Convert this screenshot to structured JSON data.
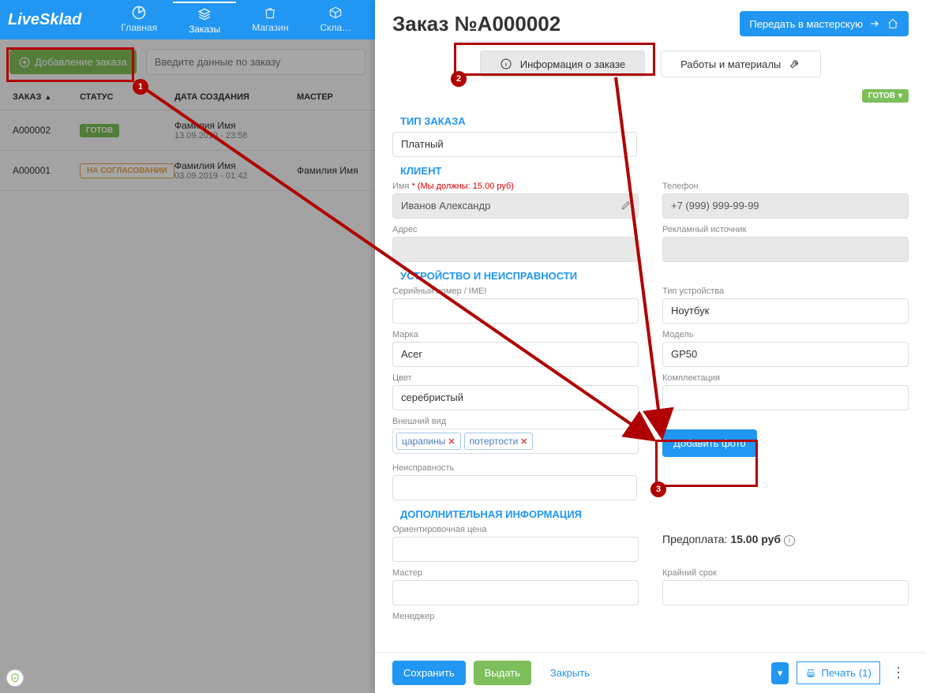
{
  "colors": {
    "primary": "#2196f3",
    "success": "#7dbf5a",
    "danger": "#b00000"
  },
  "nav": {
    "logo": "LiveSklad",
    "items": [
      {
        "label": "Главная",
        "icon": "pie"
      },
      {
        "label": "Заказы",
        "icon": "stack",
        "active": true
      },
      {
        "label": "Магазин",
        "icon": "bag"
      },
      {
        "label": "Скла…",
        "icon": "box"
      }
    ]
  },
  "toolbar": {
    "add_label": "Добавление заказа",
    "search_placeholder": "Введите данные по заказу"
  },
  "table": {
    "headers": {
      "id": "ЗАКАЗ",
      "status": "СТАТУС",
      "created": "ДАТА СОЗДАНИЯ",
      "master": "МАСТЕР"
    },
    "rows": [
      {
        "id": "A000002",
        "status": "ГОТОВ",
        "status_kind": "green",
        "name": "Фамилия Имя",
        "date": "13.09.2019 - 23:58",
        "master": ""
      },
      {
        "id": "A000001",
        "status": "НА СОГЛАСОВАНИИ",
        "status_kind": "orange",
        "name": "Фамилия Имя",
        "date": "03.09.2019 - 01:42",
        "master": "Фамилия Имя"
      }
    ]
  },
  "panel": {
    "title": "Заказ №А000002",
    "transfer_label": "Передать в мастерскую",
    "tabs": {
      "info": "Информация о заказе",
      "work": "Работы и материалы"
    },
    "status_pill": "ГОТОВ",
    "sections": {
      "order_type": {
        "title": "ТИП ЗАКАЗА",
        "value": "Платный"
      },
      "client": {
        "title": "КЛИЕНТ",
        "name_label": "Имя",
        "debt_text": "(Мы должны: 15.00 руб)",
        "name_value": "Иванов Александр",
        "phone_label": "Телефон",
        "phone_value": "+7 (999) 999-99-99",
        "address_label": "Адрес",
        "address_value": "",
        "adsource_label": "Рекламный источник",
        "adsource_value": ""
      },
      "device": {
        "title": "УСТРОЙСТВО И НЕИСПРАВНОСТИ",
        "serial_label": "Серийный номер / IMEI",
        "serial_value": "",
        "type_label": "Тип устройства",
        "type_value": "Ноутбук",
        "brand_label": "Марка",
        "brand_value": "Acer",
        "model_label": "Модель",
        "model_value": "GP50",
        "color_label": "Цвет",
        "color_value": "серебристый",
        "kit_label": "Комплектация",
        "kit_value": "",
        "look_label": "Внешний вид",
        "look_tags": [
          "царапины",
          "потертости"
        ],
        "photo_btn": "Добавить фото",
        "defect_label": "Неисправность",
        "defect_value": ""
      },
      "extra": {
        "title": "ДОПОЛНИТЕЛЬНАЯ ИНФОРМАЦИЯ",
        "price_label": "Ориентировочная цена",
        "price_value": "",
        "prepay_label": "Предоплата:",
        "prepay_value": "15.00 руб",
        "master_label": "Мастер",
        "master_value": "",
        "deadline_label": "Крайний срок",
        "deadline_value": "",
        "manager_label": "Менеджер"
      }
    },
    "footer": {
      "save": "Сохранить",
      "issue": "Выдать",
      "close": "Закрыть",
      "print": "Печать (1)"
    }
  },
  "annotations": {
    "1": "1",
    "2": "2",
    "3": "3"
  }
}
